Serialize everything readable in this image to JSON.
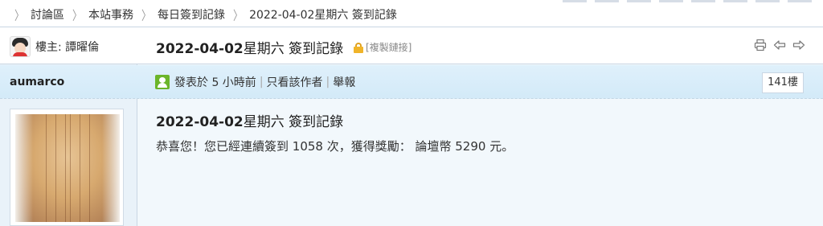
{
  "breadcrumb": [
    "討論區",
    "本站事務",
    "每日簽到記錄",
    "2022-04-02星期六 簽到記錄"
  ],
  "header": {
    "host_label": "樓主: 譚曜倫",
    "title_date": "2022-04-02",
    "title_rest": "星期六 簽到記錄",
    "copy_link": "[複製鏈接]",
    "tools": [
      "print-icon",
      "prev-thread-icon",
      "next-thread-icon"
    ]
  },
  "post": {
    "author": "aumarco",
    "posted": "發表於 5 小時前",
    "only_author": "只看該作者",
    "report": "舉報",
    "floor": "141樓",
    "title_date": "2022-04-02",
    "title_rest": "星期六 簽到記錄",
    "message": "恭喜您！您已經連續簽到 1058 次，獲得獎勵： 論壇幣 5290 元。"
  },
  "colors": {
    "accent": "#6bb52a",
    "author_bar": "#d8ecf9",
    "border": "#c9d6e3",
    "lock": "#f0b429"
  }
}
